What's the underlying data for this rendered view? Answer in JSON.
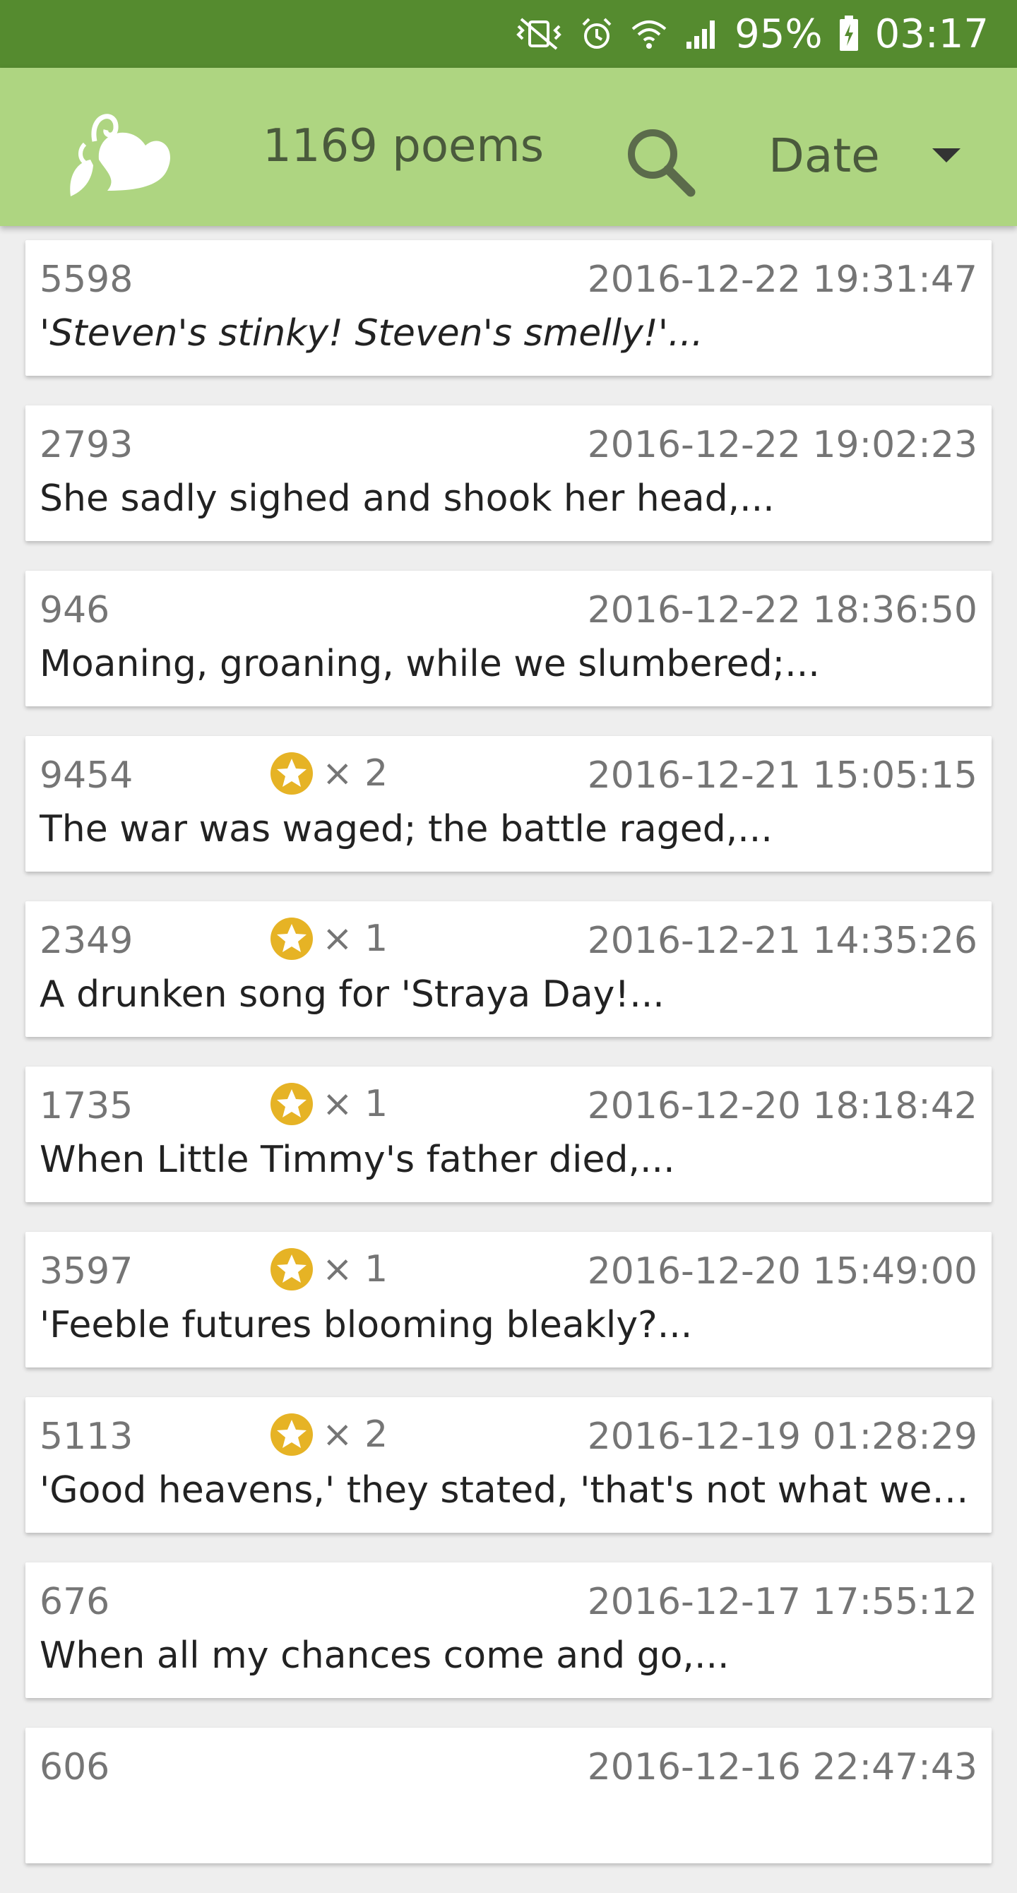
{
  "status_bar": {
    "battery_percent": "95%",
    "time": "03:17",
    "icons": [
      "vibrate-mute-icon",
      "alarm-icon",
      "wifi-icon",
      "signal-icon",
      "battery-charging-icon"
    ],
    "background": "#558b2f"
  },
  "app_bar": {
    "title": "1169 poems",
    "sort_value": "Date",
    "logo_icon": "leaf-heart-logo-icon",
    "search_icon": "search-icon",
    "background": "#aed581"
  },
  "colors": {
    "star": "#e6b325",
    "card": "#ffffff",
    "list_background": "#eeeeee"
  },
  "poems": [
    {
      "id": "5598",
      "date": "2016-12-22 19:31:47",
      "line": "'Steven's stinky! Steven's smelly!'...",
      "italic": true,
      "stars": null
    },
    {
      "id": "2793",
      "date": "2016-12-22 19:02:23",
      "line": "She sadly sighed and shook her head,...",
      "italic": false,
      "stars": null
    },
    {
      "id": "946",
      "date": "2016-12-22 18:36:50",
      "line": "Moaning, groaning, while we slumbered;...",
      "italic": false,
      "stars": null
    },
    {
      "id": "9454",
      "date": "2016-12-21 15:05:15",
      "line": "The war was waged; the battle raged,...",
      "italic": false,
      "stars": "× 2"
    },
    {
      "id": "2349",
      "date": "2016-12-21 14:35:26",
      "line": "A drunken song for 'Straya Day!...",
      "italic": false,
      "stars": "× 1"
    },
    {
      "id": "1735",
      "date": "2016-12-20 18:18:42",
      "line": "When Little Timmy's father died,...",
      "italic": false,
      "stars": "× 1"
    },
    {
      "id": "3597",
      "date": "2016-12-20 15:49:00",
      "line": "'Feeble futures blooming bleakly?...",
      "italic": false,
      "stars": "× 1"
    },
    {
      "id": "5113",
      "date": "2016-12-19 01:28:29",
      "line": "'Good heavens,' they stated, 'that's not what we need...",
      "italic": false,
      "stars": "× 2"
    },
    {
      "id": "676",
      "date": "2016-12-17 17:55:12",
      "line": "When all my chances come and go,...",
      "italic": false,
      "stars": null
    },
    {
      "id": "606",
      "date": "2016-12-16 22:47:43",
      "line": "",
      "italic": false,
      "stars": null
    }
  ]
}
